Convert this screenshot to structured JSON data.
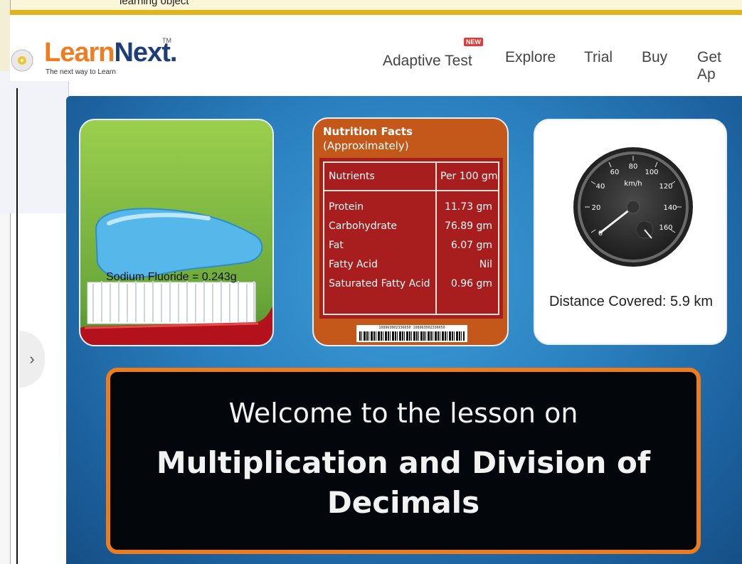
{
  "background_window": {
    "title_fragment": "learning object"
  },
  "header": {
    "logo": {
      "learn": "Learn",
      "next": "Next.",
      "tm": "TM",
      "tagline": "The next way to Learn"
    },
    "nav": [
      {
        "label": "Adaptive Test",
        "badge": "NEW"
      },
      {
        "label": "Explore"
      },
      {
        "label": "Trial"
      },
      {
        "label": "Buy"
      },
      {
        "label": "Get Ap"
      }
    ]
  },
  "carousel": {
    "prev_arrow": "›"
  },
  "lesson": {
    "toothpaste": {
      "label": "Sodium Fluoride = 0.243g"
    },
    "nutrition": {
      "title_line1": "Nutrition Facts",
      "title_line2": "(Approximately)",
      "headers": [
        "Nutrients",
        "Per 100 gm"
      ],
      "rows": [
        {
          "name": "Protein",
          "value": "11.73 gm"
        },
        {
          "name": "Carbohydrate",
          "value": "76.89 gm"
        },
        {
          "name": "Fat",
          "value": "6.07 gm"
        },
        {
          "name": "Fatty Acid",
          "value": "Nil"
        },
        {
          "name": "Saturated Fatty Acid",
          "value": "0.96 gm"
        }
      ],
      "barcode_text": "108963002336650 108963002336650"
    },
    "speedometer": {
      "unit": "km/h",
      "ticks": [
        "0",
        "20",
        "40",
        "60",
        "80",
        "100",
        "120",
        "140",
        "160"
      ],
      "distance": "Distance Covered: 5.9 km"
    },
    "welcome": {
      "line1": "Welcome to the lesson on",
      "line2a": "Multiplication and Division of",
      "line2b": "Decimals"
    }
  },
  "colors": {
    "accent_orange": "#ee7c1a",
    "brand_blue": "#1e3e7a",
    "brand_orange": "#f47b20"
  }
}
